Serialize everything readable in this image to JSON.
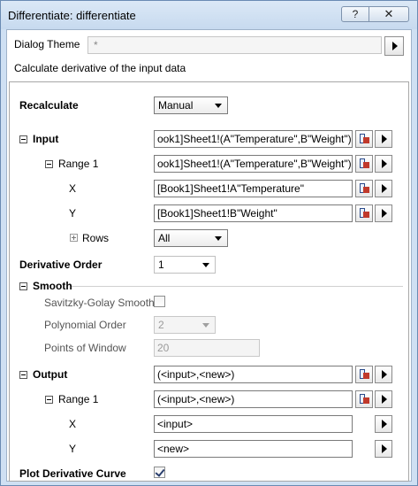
{
  "window": {
    "title": "Differentiate: differentiate",
    "help_label": "?",
    "close_label": "✕"
  },
  "theme": {
    "label": "Dialog Theme",
    "value": "*"
  },
  "description": "Calculate derivative of the input data",
  "recalculate": {
    "label": "Recalculate",
    "value": "Manual"
  },
  "input": {
    "label": "Input",
    "value": "ook1]Sheet1!(A\"Temperature\",B\"Weight\")",
    "range1": {
      "label": "Range 1",
      "value": "ook1]Sheet1!(A\"Temperature\",B\"Weight\")",
      "x_label": "X",
      "x_value": "[Book1]Sheet1!A\"Temperature\"",
      "y_label": "Y",
      "y_value": "[Book1]Sheet1!B\"Weight\"",
      "rows_label": "Rows",
      "rows_value": "All"
    }
  },
  "derivative_order": {
    "label": "Derivative Order",
    "value": "1"
  },
  "smooth": {
    "label": "Smooth",
    "sg_label": "Savitzky-Golay Smooth",
    "sg_checked": false,
    "poly_label": "Polynomial Order",
    "poly_value": "2",
    "points_label": "Points of Window",
    "points_value": "20"
  },
  "output": {
    "label": "Output",
    "value": "(<input>,<new>)",
    "range1": {
      "label": "Range 1",
      "value": "(<input>,<new>)",
      "x_label": "X",
      "x_value": "<input>",
      "y_label": "Y",
      "y_value": "<new>"
    }
  },
  "plot_curve": {
    "label": "Plot Derivative Curve",
    "checked": true
  },
  "icons": [
    "help-icon",
    "close-icon",
    "arrow-right-icon",
    "range-select-icon",
    "dropdown-icon",
    "collapse-icon",
    "expand-icon",
    "checkbox"
  ]
}
